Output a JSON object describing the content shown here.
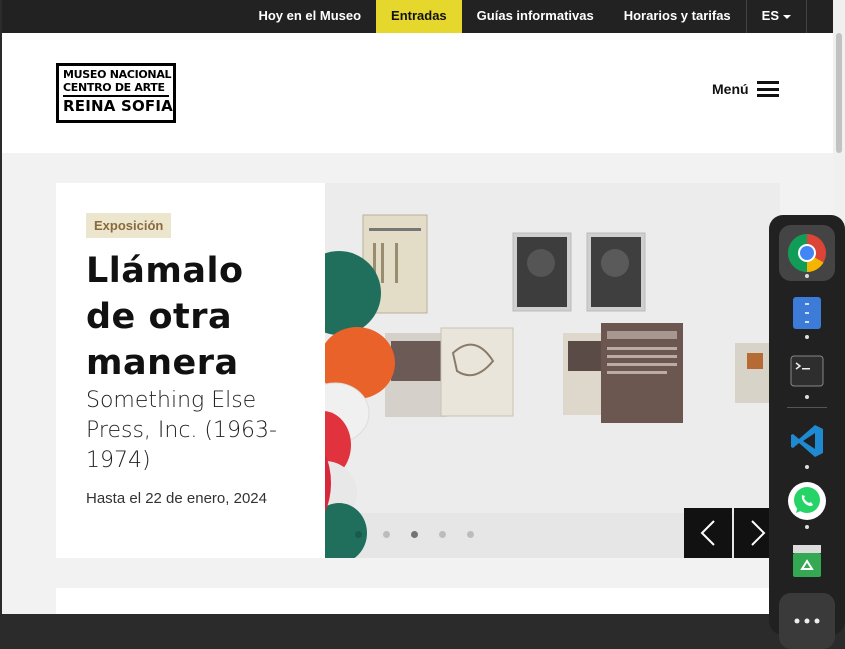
{
  "topnav": {
    "items": [
      "Hoy en el Museo",
      "Entradas",
      "Guías informativas",
      "Horarios y tarifas"
    ],
    "active_index": 1,
    "language": "ES"
  },
  "header": {
    "logo": {
      "line1": "MUSEO NACIONAL",
      "line2": "CENTRO DE ARTE",
      "line3": "REINA SOFIA"
    },
    "menu_label": "Menú"
  },
  "hero": {
    "badge": "Exposición",
    "title": "Llámalo de otra manera",
    "subtitle": "Something Else Press, Inc. (1963-1974)",
    "date": "Hasta el 22 de enero, 2024",
    "active_slide": 3,
    "slide_count": 5
  },
  "dock": {
    "apps": [
      "chrome-icon",
      "files-icon",
      "terminal-icon",
      "vscode-icon",
      "whatsapp-icon",
      "trash-icon",
      "app-grid-icon"
    ]
  },
  "colors": {
    "topbar_bg": "#222222",
    "active_tab": "#e6d72d",
    "badge_bg": "#ece6cf",
    "badge_text": "#8a6a3d",
    "arrow_bg": "#111111"
  }
}
